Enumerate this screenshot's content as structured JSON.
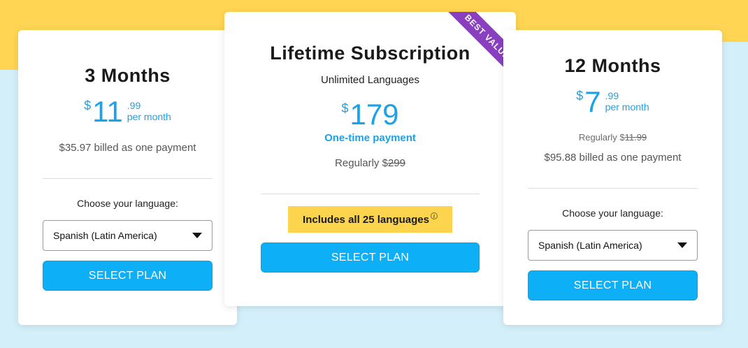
{
  "plans": {
    "three_months": {
      "title": "3 Months",
      "currency": "$",
      "amount": "11",
      "cents": ".99",
      "per": "per month",
      "billed": "$35.97 billed as one payment",
      "choose_label": "Choose your language:",
      "language_selected": "Spanish (Latin America)",
      "button_label": "SELECT PLAN"
    },
    "lifetime": {
      "title": "Lifetime Subscription",
      "subtitle": "Unlimited Languages",
      "currency": "$",
      "amount": "179",
      "payment_note": "One-time payment",
      "regular_prefix": "Regularly $",
      "regular_price": "299",
      "ribbon": "BEST VALUE",
      "includes": "Includes all 25 languages",
      "info_glyph": "i",
      "button_label": "SELECT PLAN"
    },
    "twelve_months": {
      "title": "12 Months",
      "currency": "$",
      "amount": "7",
      "cents": ".99",
      "per": "per month",
      "regular_prefix": "Regularly $",
      "regular_price": "11.99",
      "billed": "$95.88 billed as one payment",
      "choose_label": "Choose your language:",
      "language_selected": "Spanish (Latin America)",
      "button_label": "SELECT PLAN"
    }
  },
  "colors": {
    "accent_blue": "#0db0f7",
    "price_blue": "#1aa3e8",
    "ribbon_purple": "#8a3fc1",
    "highlight_yellow": "#fdd44e",
    "bg_yellow": "#ffd553",
    "bg_light_blue": "#d3effa"
  },
  "icons": {
    "caret": "chevron-down-icon",
    "info": "info-icon"
  }
}
